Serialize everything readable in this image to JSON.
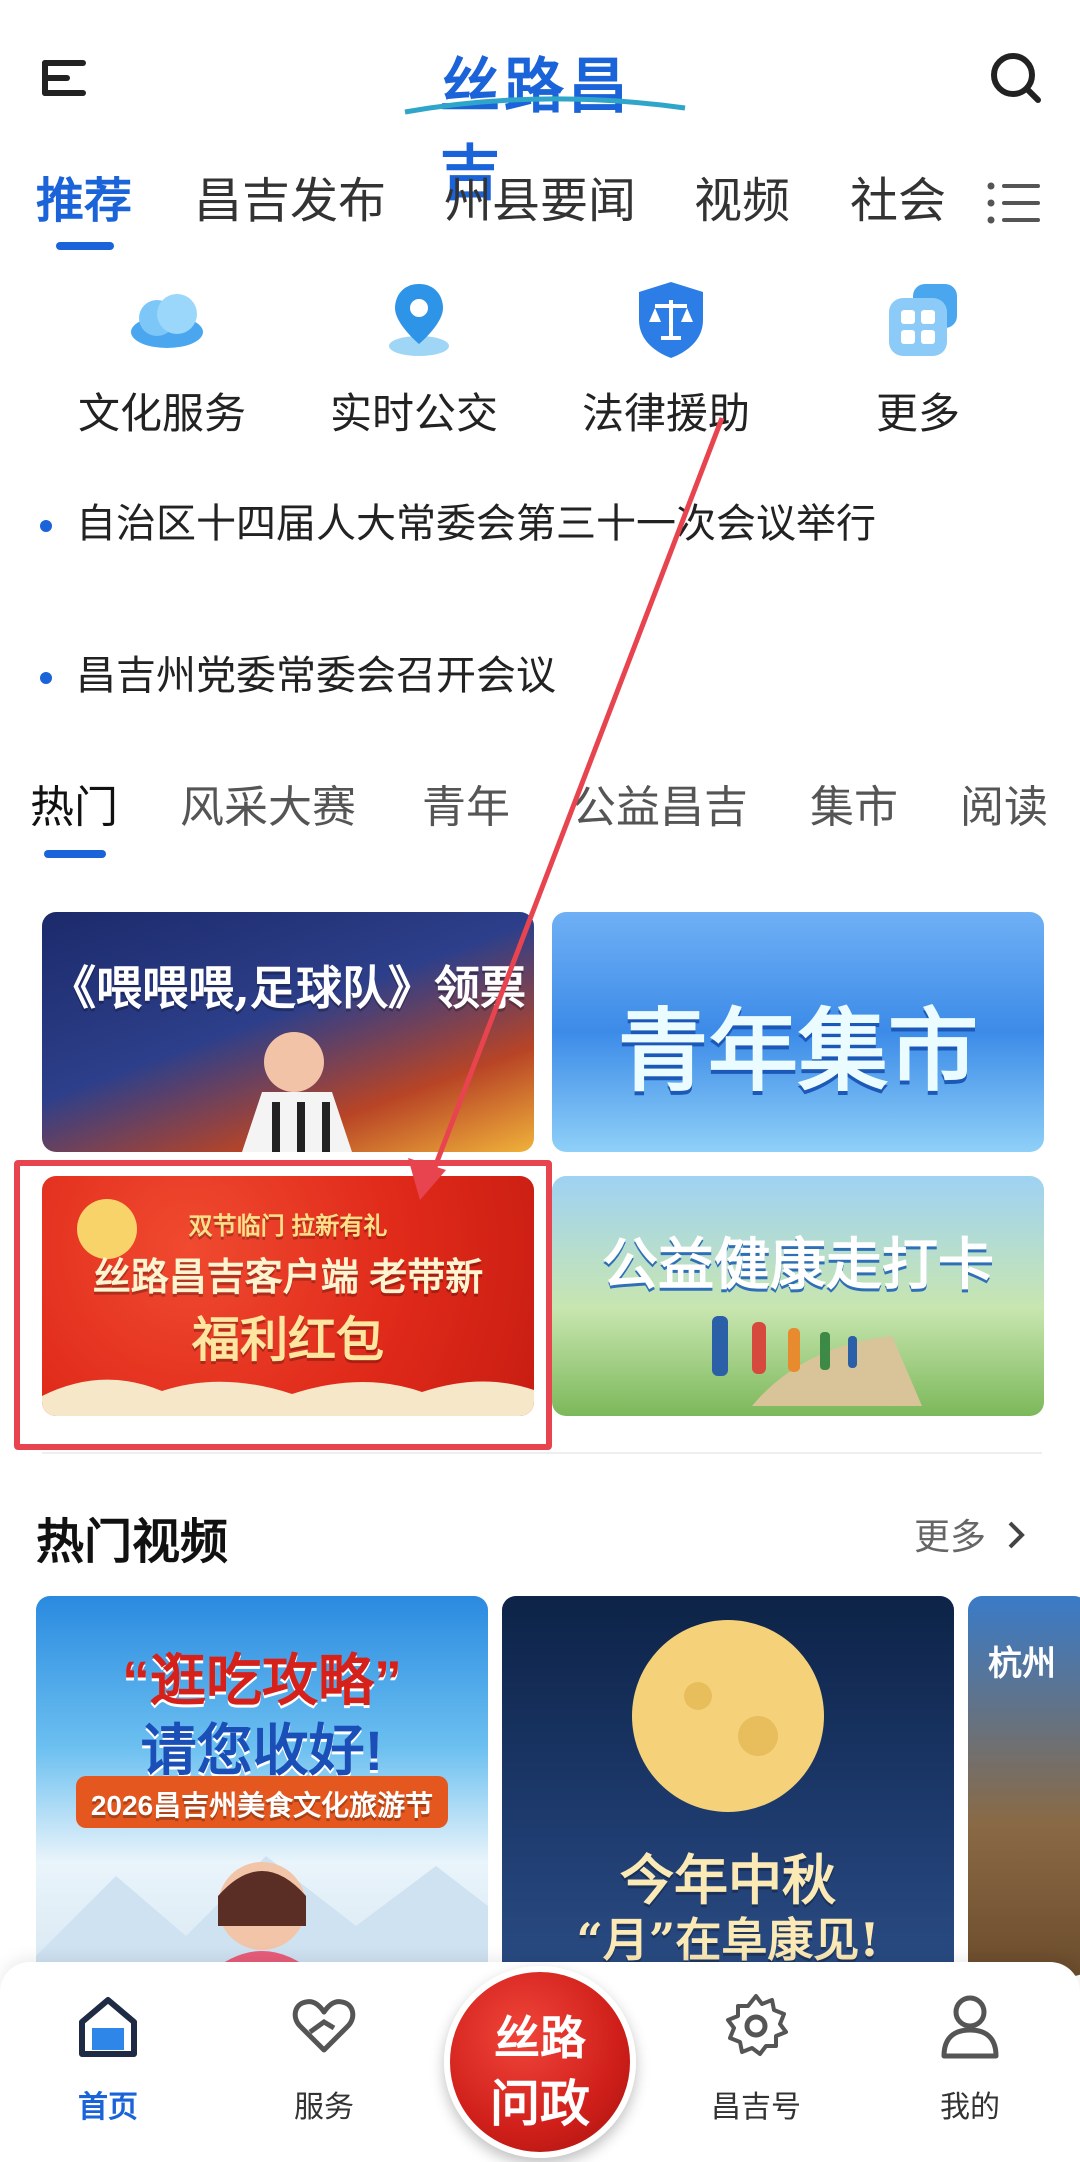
{
  "header": {
    "logo_text": "丝路昌吉",
    "menu_icon": "menu-icon",
    "search_icon": "search-icon"
  },
  "channel_tabs": {
    "items": [
      "推荐",
      "昌吉发布",
      "州县要闻",
      "视频",
      "社会"
    ],
    "active_index": 0,
    "more_icon": "list-icon"
  },
  "quick_services": [
    {
      "label": "文化服务",
      "icon": "cloud-icon"
    },
    {
      "label": "实时公交",
      "icon": "location-pin-icon"
    },
    {
      "label": "法律援助",
      "icon": "scales-shield-icon"
    },
    {
      "label": "更多",
      "icon": "grid-apps-icon"
    }
  ],
  "headlines": [
    "自治区十四届人大常委会第三十一次会议举行",
    "昌吉州党委常委会召开会议"
  ],
  "section_tabs": {
    "items": [
      "热门",
      "风采大赛",
      "青年",
      "公益昌吉",
      "集市",
      "阅读"
    ],
    "active_index": 0
  },
  "banners": {
    "b1": {
      "title": "《喂喂喂,足球队》领票"
    },
    "b2": {
      "title": "青年集市"
    },
    "b3": {
      "small": "双节临门  拉新有礼",
      "line1": "丝路昌吉客户端 老带新",
      "line2": "福利红包"
    },
    "b4": {
      "title": "公益健康走打卡"
    }
  },
  "hot_videos": {
    "title": "热门视频",
    "more_label": "更多",
    "cards": [
      {
        "line1": "“逛吃攻略”",
        "line2": "请您收好!",
        "line3": "2026昌吉州美食文化旅游节"
      },
      {
        "line1": "今年中秋",
        "line2": "“月”在阜康见!"
      },
      {
        "line1": "杭州"
      }
    ]
  },
  "bottom_nav": {
    "items": [
      {
        "label": "首页",
        "icon": "home-icon"
      },
      {
        "label": "服务",
        "icon": "heart-hand-icon"
      },
      {
        "label": "昌吉号",
        "icon": "gear-badge-icon"
      },
      {
        "label": "我的",
        "icon": "user-icon"
      }
    ],
    "active_index": 0,
    "center": {
      "line1": "丝路",
      "line2": "问政"
    }
  },
  "colors": {
    "accent": "#1a63d8",
    "highlight_box": "#e8444f",
    "center_button": "#d01f1a"
  }
}
